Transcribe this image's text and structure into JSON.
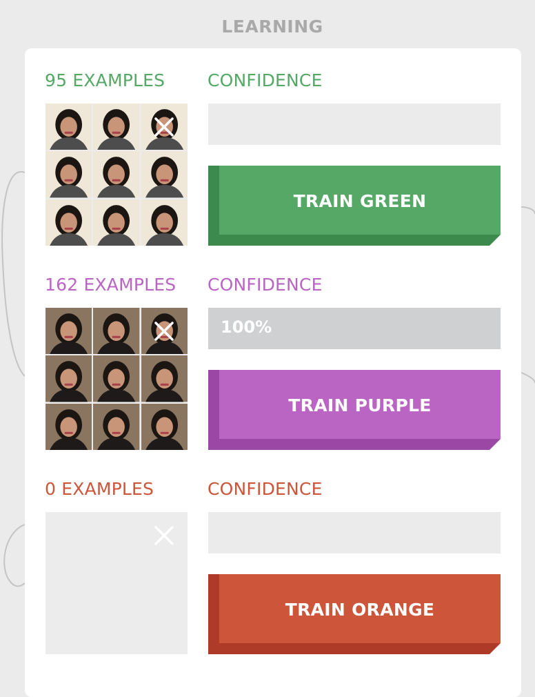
{
  "section_title": "LEARNING",
  "classes": [
    {
      "id": "green",
      "examples_label": "95 EXAMPLES",
      "confidence_label": "CONFIDENCE",
      "confidence_value": "",
      "confidence_fraction": 0,
      "button_label": "TRAIN GREEN",
      "color": "#55a865",
      "dark_color": "#3d8a4d",
      "thumbnail_count": 9,
      "thumbnail_backdrop": "#efe8d8",
      "thumbnail_clothing": "#4d4d4d"
    },
    {
      "id": "purple",
      "examples_label": "162 EXAMPLES",
      "confidence_label": "CONFIDENCE",
      "confidence_value": "100%",
      "confidence_fraction": 1,
      "button_label": "TRAIN PURPLE",
      "color": "#ba64c4",
      "dark_color": "#9a47a5",
      "thumbnail_count": 9,
      "thumbnail_backdrop": "#8a7560",
      "thumbnail_clothing": "#1e1a1a"
    },
    {
      "id": "orange",
      "examples_label": "0 EXAMPLES",
      "confidence_label": "CONFIDENCE",
      "confidence_value": "",
      "confidence_fraction": 0,
      "button_label": "TRAIN ORANGE",
      "color": "#cc553a",
      "dark_color": "#ad3b27",
      "thumbnail_count": 0,
      "thumbnail_backdrop": "#ececec",
      "thumbnail_clothing": "#ececec"
    }
  ],
  "icons": {
    "clear": "close-icon",
    "thumbnail": "webcam-frame-icon"
  },
  "colors": {
    "page_background": "#ebebeb",
    "card_background": "#ffffff",
    "title": "#a9a9a9",
    "confidence_track": "#ebebeb",
    "confidence_fill": "#cfd0d2"
  }
}
